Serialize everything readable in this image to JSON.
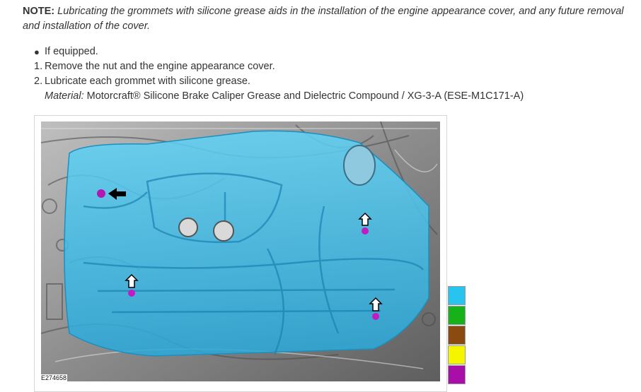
{
  "note": {
    "label": "NOTE:",
    "text": "Lubricating the grommets with silicone grease aids in the installation of the engine appearance cover, and any future removal and installation of the cover."
  },
  "steps": {
    "bullet_text": "If equipped.",
    "items": [
      {
        "number": "1.",
        "text": "Remove the nut and the engine appearance cover."
      },
      {
        "number": "2.",
        "text": "Lubricate each grommet with silicone grease."
      }
    ],
    "material_label": "Material:",
    "material_text": " Motorcraft® Silicone Brake Caliper Grease and Dielectric Compound / XG-3-A (ESE-M1C171-A)"
  },
  "figure": {
    "id": "E274658"
  },
  "legend": {
    "colors": [
      "#29c3f0",
      "#17b21a",
      "#8b4a10",
      "#f5f500",
      "#a80fa8"
    ]
  }
}
